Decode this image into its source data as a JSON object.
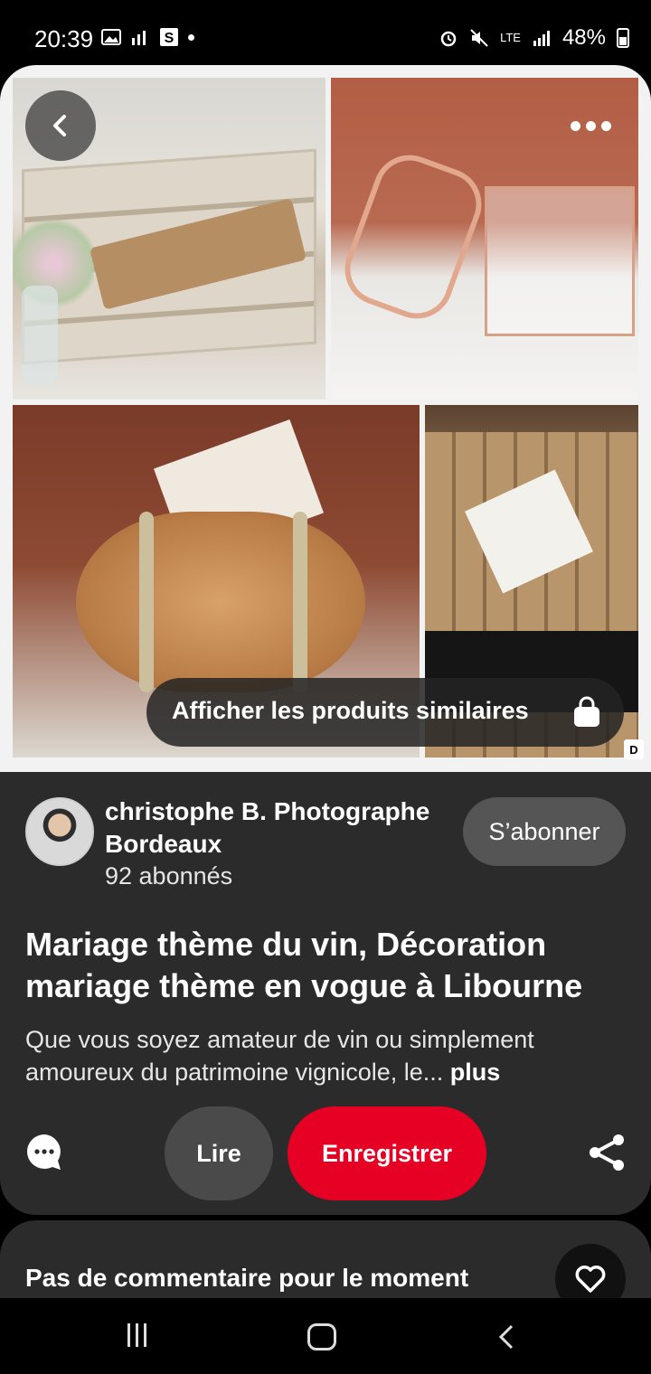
{
  "status_bar": {
    "time": "20:39",
    "network": "LTE",
    "battery": "48%"
  },
  "hero": {
    "similar_label": "Afficher les produits similaires",
    "watermark": "D",
    "icons": [
      "chevron-left-icon",
      "more-horizontal-icon",
      "shopping-bag-icon"
    ]
  },
  "creator": {
    "name": "christophe B. Photographe Bordeaux",
    "followers": "92 abonnés",
    "follow_label": "S’abonner"
  },
  "pin": {
    "title": "Mariage thème du vin, Décoration mariage thème en vogue à Libourne",
    "description": "Que vous soyez amateur de vin ou simplement amoureux du patrimoine vignicole, le...",
    "more_label": "plus"
  },
  "actions": {
    "read_label": "Lire",
    "save_label": "Enregistrer",
    "save_color": "#e60023"
  },
  "comments": {
    "title": "Pas de commentaire pour le moment"
  }
}
